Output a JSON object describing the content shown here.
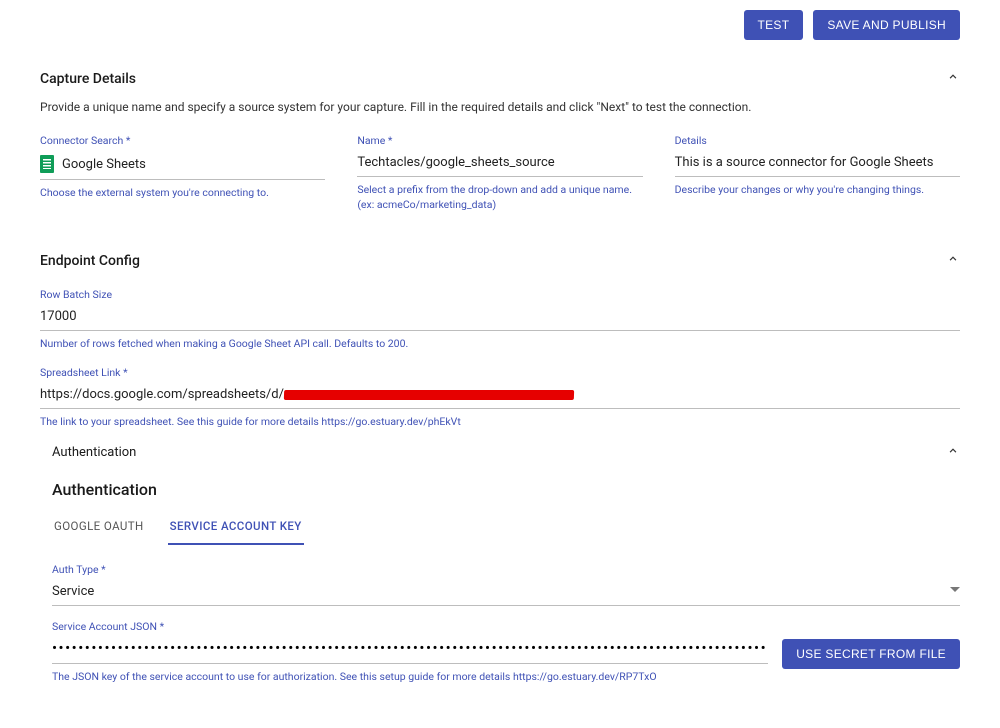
{
  "topbar": {
    "test_label": "TEST",
    "save_label": "SAVE AND PUBLISH"
  },
  "capture": {
    "title": "Capture Details",
    "description": "Provide a unique name and specify a source system for your capture. Fill in the required details and click \"Next\" to test the connection.",
    "connector_search": {
      "label": "Connector Search *",
      "value": "Google Sheets",
      "helper": "Choose the external system you're connecting to."
    },
    "name": {
      "label": "Name *",
      "value": "Techtacles/google_sheets_source",
      "helper": "Select a prefix from the drop-down and add a unique name. (ex: acmeCo/marketing_data)"
    },
    "details": {
      "label": "Details",
      "value": "This is a source connector for Google Sheets",
      "helper": "Describe your changes or why you're changing things."
    }
  },
  "endpoint": {
    "title": "Endpoint Config",
    "row_batch": {
      "label": "Row Batch Size",
      "value": "17000",
      "helper": "Number of rows fetched when making a Google Sheet API call. Defaults to 200."
    },
    "spreadsheet_link": {
      "label": "Spreadsheet Link *",
      "prefix": "https://docs.google.com/spreadsheets/d/",
      "helper": "The link to your spreadsheet. See this guide for more details https://go.estuary.dev/phEkVt"
    },
    "auth_section": {
      "header": "Authentication"
    },
    "auth_block": {
      "title": "Authentication",
      "tabs": [
        {
          "label": "GOOGLE OAUTH",
          "active": false
        },
        {
          "label": "SERVICE ACCOUNT KEY",
          "active": true
        }
      ],
      "auth_type": {
        "label": "Auth Type *",
        "value": "Service"
      },
      "service_json": {
        "label": "Service Account JSON *",
        "masked": "•••••••••••••••••••••••••••••••••••••••••••••••••••••••••••••••••••••••••••••••••••••••••••••••••••••••••••••••••••••••••••••••••••••••••••••••••••••••••••••••••••••••••••••••••",
        "helper": "The JSON key of the service account to use for authorization. See this setup guide for more details https://go.estuary.dev/RP7TxO",
        "button": "USE SECRET FROM FILE"
      }
    }
  }
}
